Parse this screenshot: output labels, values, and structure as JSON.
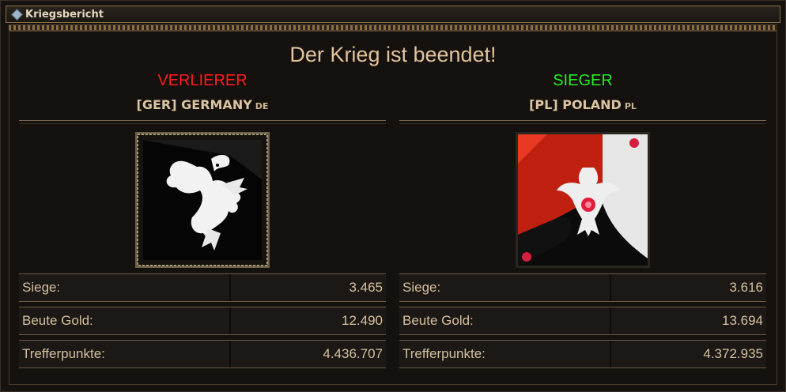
{
  "window": {
    "title": "Kriegsbericht"
  },
  "headline": "Der Krieg ist beendet!",
  "loser": {
    "status": "VERLIERER",
    "nation_name": "[GER] GERMANY",
    "nation_code": "DE",
    "flag_icon": "black-griffin-banner-icon"
  },
  "winner": {
    "status": "SIEGER",
    "nation_name": "[PL] POLAND",
    "nation_code": "PL",
    "flag_icon": "white-eagle-red-banner-icon"
  },
  "stats": {
    "labels": [
      "Siege:",
      "Beute Gold:",
      "Trefferpunkte:"
    ],
    "loser_values": [
      "3.465",
      "12.490",
      "4.436.707"
    ],
    "winner_values": [
      "3.616",
      "13.694",
      "4.372.935"
    ]
  },
  "colors": {
    "loser": "#ff1a1a",
    "winner": "#22ee22",
    "accent": "#e3c39a"
  }
}
